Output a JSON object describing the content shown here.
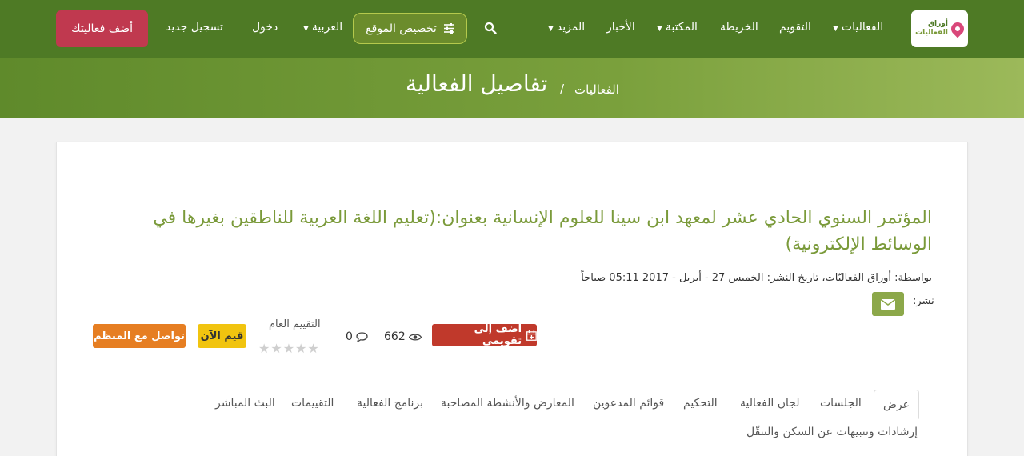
{
  "header": {
    "logo": {
      "line1": "أوراق",
      "line2": "الفعاليات"
    },
    "nav": {
      "events": "الفعاليات",
      "calendar": "التقويم",
      "map": "الخريطة",
      "library": "المكتبة",
      "news": "الأخبار",
      "more": "المزيد",
      "customize": "تخصيص الموقع",
      "language": "العربية",
      "login": "دخول",
      "register": "تسجيل جديد",
      "add_event": "أضف فعاليتك"
    },
    "colors": {
      "bar": "#4e7a25",
      "add_button": "#c0394f"
    }
  },
  "banner": {
    "title": "تفاصيل الفعالية",
    "separator": "/",
    "breadcrumb": "الفعاليات"
  },
  "event": {
    "title": "المؤتمر السنوي الحادي عشر لمعهد ابن سينا  للعلوم الإنسانية بعنوان:(تعليم اللغة العربية للناطقين بغيرها في الوسائط الإلكترونية)",
    "meta": "بواسطة: أوراق الفعاليّات، تاريخ النشر: الخميس 27 - أبريل - 2017 05:11 صباحاً",
    "share_label": "نشر:",
    "calendar_button": "أضف إلى تقويمي",
    "views": "662",
    "comments": "0",
    "rating_label": "التقييم العام",
    "rating_value": 0,
    "rating_max": 5,
    "rate_button": "قيم الآن",
    "contact_button": "تواصل مع المنظم"
  },
  "tabs": [
    "عرض",
    "الجلسات",
    "لجان الفعالية",
    "التحكيم",
    "قوائم المدعوين",
    "المعارض والأنشطة المصاحبة",
    "برنامج الفعالية",
    "التقييمات",
    "البث المباشر",
    "إرشادات وتنبيهات عن السكن والتنقّل"
  ]
}
